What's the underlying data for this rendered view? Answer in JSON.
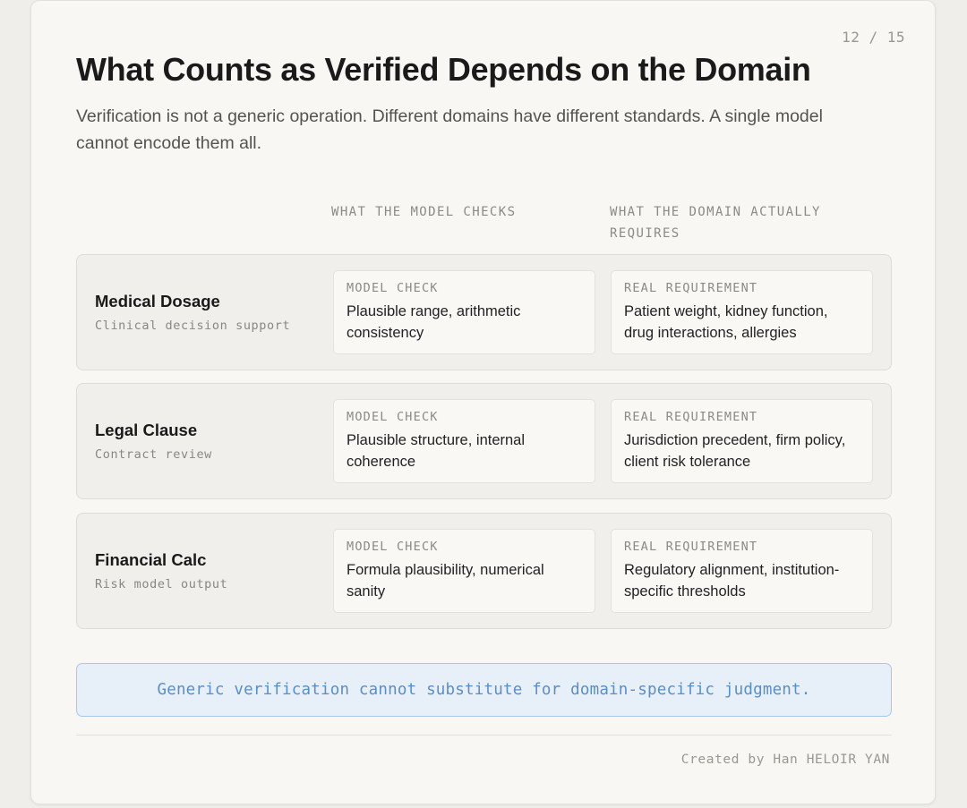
{
  "slide": {
    "page_indicator": "12 / 15",
    "title": "What Counts as Verified Depends on the Domain",
    "subtitle": "Verification is not a generic operation. Different domains have different standards. A single model cannot encode them all."
  },
  "columns": {
    "model_header": "WHAT THE MODEL CHECKS",
    "domain_header": "WHAT THE DOMAIN ACTUALLY REQUIRES"
  },
  "rows": [
    {
      "name": "Medical Dosage",
      "context": "Clinical decision support",
      "model_tag": "MODEL CHECK",
      "model_text": "Plausible range, arithmetic consistency",
      "req_tag": "REAL REQUIREMENT",
      "req_text": "Patient weight, kidney function, drug interactions, allergies"
    },
    {
      "name": "Legal Clause",
      "context": "Contract review",
      "model_tag": "MODEL CHECK",
      "model_text": "Plausible structure, internal coherence",
      "req_tag": "REAL REQUIREMENT",
      "req_text": "Jurisdiction precedent, firm policy, client risk tolerance"
    },
    {
      "name": "Financial Calc",
      "context": "Risk model output",
      "model_tag": "MODEL CHECK",
      "model_text": "Formula plausibility, numerical sanity",
      "req_tag": "REAL REQUIREMENT",
      "req_text": "Regulatory alignment, institution-specific thresholds"
    }
  ],
  "callout": {
    "text": "Generic verification cannot substitute for domain-specific judgment."
  },
  "footer": {
    "credit": "Created by Han HELOIR YAN"
  },
  "colors": {
    "background": "#efeeea",
    "card": "#f8f7f3",
    "callout_fill": "#e7eff8",
    "callout_border": "#a9c8e8",
    "callout_text": "#5a8fc4"
  }
}
